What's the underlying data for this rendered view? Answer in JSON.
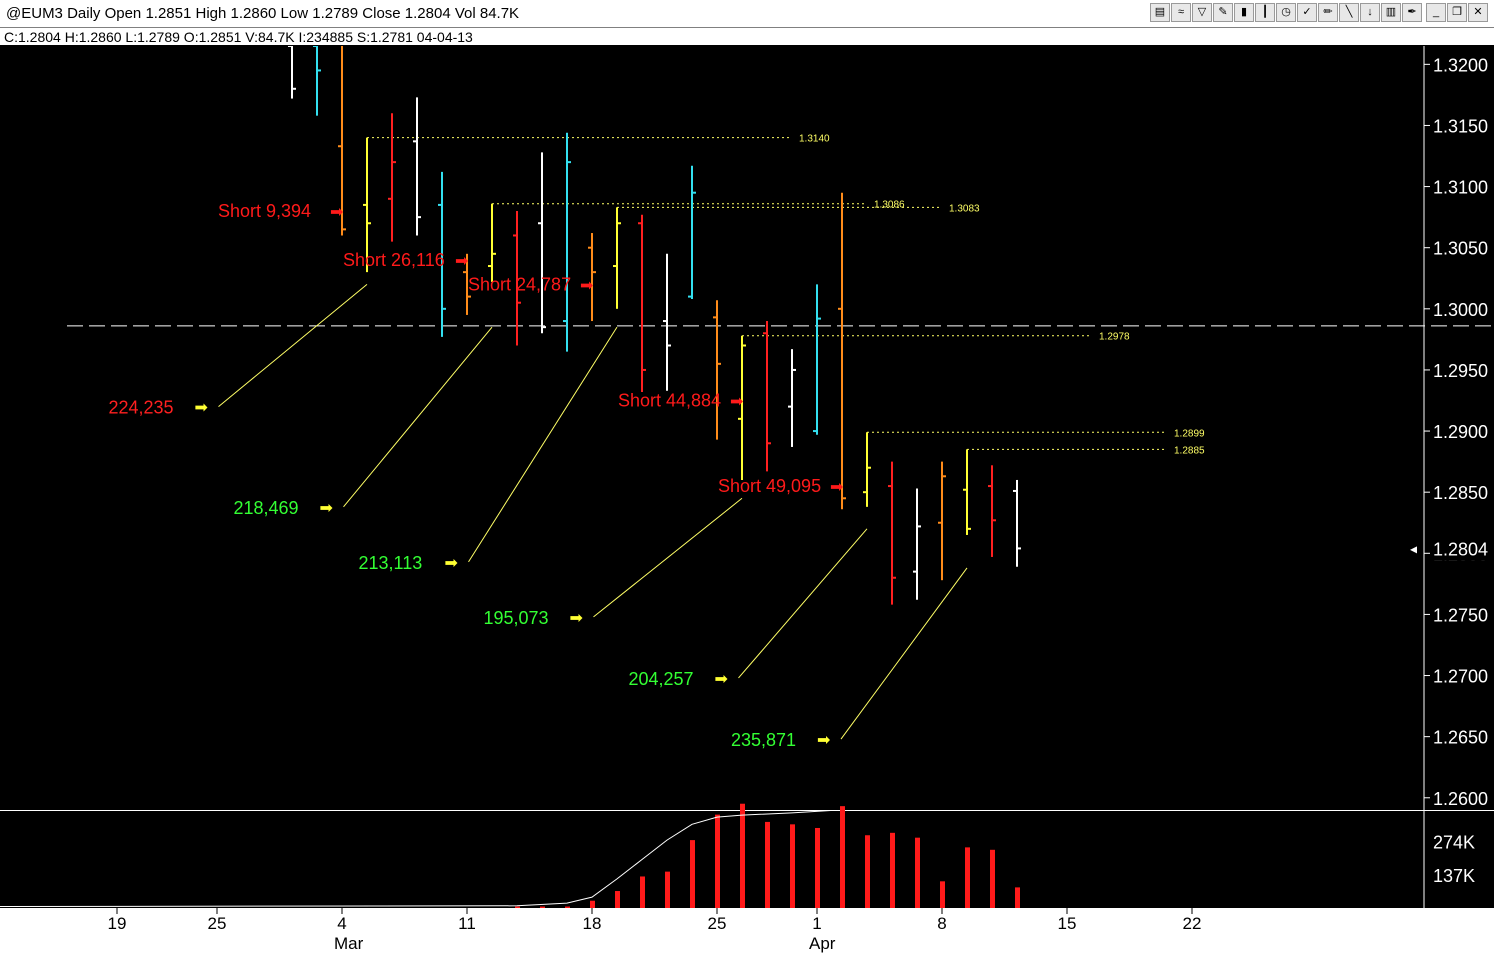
{
  "window": {
    "title": "@EUM3 Daily Open 1.2851 High 1.2860 Low 1.2789 Close 1.2804 Vol 84.7K",
    "status_line": "C:1.2804  H:1.2860  L:1.2789  O:1.2851  V:84.7K  I:234885  S:1.2781  04-04-13",
    "toolbar_icons": [
      "chart-icon",
      "wave-icon",
      "filter-icon",
      "drawing-icon",
      "bars-icon",
      "candle-icon",
      "clock-icon",
      "check-icon",
      "pencil-icon",
      "line-icon",
      "arrow-down-icon",
      "trash-icon",
      "pen-icon",
      "minimize-icon",
      "restore-icon",
      "close-icon"
    ]
  },
  "chart_data": {
    "type": "ohlc",
    "price_ylim": [
      1.259,
      1.3215
    ],
    "volume_ylim": [
      0,
      400000
    ],
    "y_ticks": [
      "1.3200",
      "1.3150",
      "1.3100",
      "1.3050",
      "1.3000",
      "1.2950",
      "1.2900",
      "1.2850",
      "1.2800",
      "1.2750",
      "1.2700",
      "1.2650",
      "1.2600"
    ],
    "last_price_label": "1.2804",
    "volume_ticks": [
      "274K",
      "137K"
    ],
    "x_ticks": [
      {
        "slot": -5,
        "label": "11"
      },
      {
        "slot": 0,
        "label": "19"
      },
      {
        "slot": 4,
        "label": "25"
      },
      {
        "slot": 9,
        "label": "4",
        "month": "Mar"
      },
      {
        "slot": 14,
        "label": "11"
      },
      {
        "slot": 19,
        "label": "18"
      },
      {
        "slot": 24,
        "label": "25"
      },
      {
        "slot": 28,
        "label": "1",
        "month": "Apr"
      },
      {
        "slot": 33,
        "label": "8"
      },
      {
        "slot": 38,
        "label": "15"
      },
      {
        "slot": 43,
        "label": "22"
      }
    ],
    "bars": [
      {
        "slot": 2,
        "o": 1.3215,
        "h": 1.3215,
        "l": 1.3172,
        "c": 1.318,
        "color": "#ffffff",
        "v": 0
      },
      {
        "slot": 3,
        "o": 1.3215,
        "h": 1.3215,
        "l": 1.3158,
        "c": 1.3195,
        "color": "#33e0f0",
        "v": 0
      },
      {
        "slot": 4,
        "o": 1.3133,
        "h": 1.3215,
        "l": 1.306,
        "c": 1.3065,
        "color": "#ff8c1a",
        "v": 0
      },
      {
        "slot": 5,
        "o": 1.3085,
        "h": 1.314,
        "l": 1.303,
        "c": 1.307,
        "color": "#ffff33",
        "v": 0
      },
      {
        "slot": 6,
        "o": 1.309,
        "h": 1.316,
        "l": 1.3055,
        "c": 1.312,
        "color": "#ff2020",
        "v": 0
      },
      {
        "slot": 7,
        "o": 1.3137,
        "h": 1.3173,
        "l": 1.306,
        "c": 1.3075,
        "color": "#ffffff",
        "v": 0
      },
      {
        "slot": 8,
        "o": 1.3085,
        "h": 1.3112,
        "l": 1.2977,
        "c": 1.3,
        "color": "#33e0f0",
        "v": 0
      },
      {
        "slot": 9,
        "o": 1.303,
        "h": 1.3045,
        "l": 1.2995,
        "c": 1.301,
        "color": "#ff8c1a",
        "v": 0
      },
      {
        "slot": 10,
        "o": 1.3035,
        "h": 1.3086,
        "l": 1.3022,
        "c": 1.3045,
        "color": "#ffff33",
        "v": 0
      },
      {
        "slot": 11,
        "o": 1.306,
        "h": 1.308,
        "l": 1.297,
        "c": 1.3005,
        "color": "#ff2020",
        "v": 6000
      },
      {
        "slot": 12,
        "o": 1.307,
        "h": 1.3128,
        "l": 1.298,
        "c": 1.2985,
        "color": "#ffffff",
        "v": 6000
      },
      {
        "slot": 13,
        "o": 1.299,
        "h": 1.3144,
        "l": 1.2965,
        "c": 1.312,
        "color": "#33e0f0",
        "v": 6000
      },
      {
        "slot": 14,
        "o": 1.305,
        "h": 1.3062,
        "l": 1.299,
        "c": 1.303,
        "color": "#ff8c1a",
        "v": 30000
      },
      {
        "slot": 15,
        "o": 1.3035,
        "h": 1.3083,
        "l": 1.3,
        "c": 1.307,
        "color": "#ffff33",
        "v": 70000
      },
      {
        "slot": 16,
        "o": 1.307,
        "h": 1.3077,
        "l": 1.2932,
        "c": 1.295,
        "color": "#ff2020",
        "v": 130000
      },
      {
        "slot": 17,
        "o": 1.299,
        "h": 1.3045,
        "l": 1.2933,
        "c": 1.297,
        "color": "#ffffff",
        "v": 150000
      },
      {
        "slot": 18,
        "o": 1.301,
        "h": 1.3117,
        "l": 1.3008,
        "c": 1.3095,
        "color": "#33e0f0",
        "v": 280000
      },
      {
        "slot": 19,
        "o": 1.2993,
        "h": 1.3007,
        "l": 1.2893,
        "c": 1.2955,
        "color": "#ff8c1a",
        "v": 385000
      },
      {
        "slot": 20,
        "o": 1.291,
        "h": 1.2978,
        "l": 1.286,
        "c": 1.297,
        "color": "#ffff33",
        "v": 430000
      },
      {
        "slot": 21,
        "o": 1.298,
        "h": 1.299,
        "l": 1.2867,
        "c": 1.289,
        "color": "#ff2020",
        "v": 355000
      },
      {
        "slot": 22,
        "o": 1.292,
        "h": 1.2967,
        "l": 1.2887,
        "c": 1.295,
        "color": "#ffffff",
        "v": 345000
      },
      {
        "slot": 23,
        "o": 1.29,
        "h": 1.302,
        "l": 1.2897,
        "c": 1.2992,
        "color": "#33e0f0",
        "v": 330000
      },
      {
        "slot": 24,
        "o": 1.3,
        "h": 1.3095,
        "l": 1.2836,
        "c": 1.2845,
        "color": "#ff8c1a",
        "v": 420000
      },
      {
        "slot": 25,
        "o": 1.285,
        "h": 1.2899,
        "l": 1.2838,
        "c": 1.287,
        "color": "#ffff33",
        "v": 300000
      },
      {
        "slot": 26,
        "o": 1.2855,
        "h": 1.2875,
        "l": 1.2758,
        "c": 1.278,
        "color": "#ff2020",
        "v": 310000
      },
      {
        "slot": 27,
        "o": 1.2785,
        "h": 1.2853,
        "l": 1.2762,
        "c": 1.2822,
        "color": "#ffffff",
        "v": 290000
      },
      {
        "slot": 28,
        "o": 1.2825,
        "h": 1.2875,
        "l": 1.2778,
        "c": 1.2863,
        "color": "#ff8c1a",
        "v": 110000
      },
      {
        "slot": 29,
        "o": 1.2852,
        "h": 1.2885,
        "l": 1.2815,
        "c": 1.282,
        "color": "#ffff33",
        "v": 250000
      },
      {
        "slot": 30,
        "o": 1.2855,
        "h": 1.2872,
        "l": 1.2797,
        "c": 1.2827,
        "color": "#ff2020",
        "v": 240000
      },
      {
        "slot": 31,
        "o": 1.2851,
        "h": 1.286,
        "l": 1.2789,
        "c": 1.2804,
        "color": "#ffffff",
        "v": 85000
      }
    ],
    "open_interest_line": [
      {
        "slot": -17,
        "v": 5000
      },
      {
        "slot": 11,
        "v": 9000
      },
      {
        "slot": 13,
        "v": 20000
      },
      {
        "slot": 14,
        "v": 45000
      },
      {
        "slot": 15,
        "v": 120000
      },
      {
        "slot": 16,
        "v": 200000
      },
      {
        "slot": 17,
        "v": 280000
      },
      {
        "slot": 18,
        "v": 345000
      },
      {
        "slot": 19,
        "v": 375000
      },
      {
        "slot": 20,
        "v": 383000
      },
      {
        "slot": 22,
        "v": 392000
      },
      {
        "slot": 24,
        "v": 405000
      },
      {
        "slot": 25,
        "v": 425000
      },
      {
        "slot": 28,
        "v": 440000
      },
      {
        "slot": 29,
        "v": 465000
      },
      {
        "slot": 31,
        "v": 470000
      }
    ],
    "horizontal_lines": [
      {
        "from_slot": 5,
        "to_slot": 22,
        "price": 1.314,
        "label": "1.3140",
        "color": "#ffff66",
        "style": "dotted"
      },
      {
        "from_slot": 10,
        "to_slot": 25,
        "price": 1.3086,
        "label": "1.3086",
        "color": "#ffff66",
        "style": "dotted"
      },
      {
        "from_slot": 15,
        "to_slot": 28,
        "price": 1.3083,
        "label": "1.3083",
        "color": "#ffff66",
        "style": "dotted"
      },
      {
        "from_slot": 20,
        "to_slot": 34,
        "price": 1.2978,
        "label": "1.2978",
        "color": "#ffff66",
        "style": "dotted"
      },
      {
        "from_slot": 25,
        "to_slot": 37,
        "price": 1.2899,
        "label": "1.2899",
        "color": "#ffff66",
        "style": "dotted"
      },
      {
        "from_slot": 29,
        "to_slot": 37,
        "price": 1.2885,
        "label": "1.2885",
        "color": "#ffff66",
        "style": "dotted"
      },
      {
        "from_slot": -7,
        "to_slot": 51,
        "price": 1.2986,
        "label": "1.2986",
        "color": "#ffffff",
        "style": "dashed"
      }
    ],
    "short_annotations": [
      {
        "text": "Short  9,394",
        "slot": 4,
        "price": 1.308
      },
      {
        "text": "Short  26,116",
        "slot": 9,
        "price": 1.304
      },
      {
        "text": "Short  24,787",
        "slot": 14,
        "price": 1.302
      },
      {
        "text": "Short  44,884",
        "slot": 20,
        "price": 1.2925
      },
      {
        "text": "Short  49,095",
        "slot": 24,
        "price": 1.2855
      }
    ],
    "oi_annotations": [
      {
        "text": "224,235",
        "color": "#ff2020",
        "arrow_slot": -1.5,
        "price": 1.292,
        "line_to_slot": 5,
        "line_to_price": 1.302
      },
      {
        "text": "218,469",
        "color": "#33ff33",
        "arrow_slot": 3.5,
        "price": 1.2838,
        "line_to_slot": 10,
        "line_to_price": 1.2985
      },
      {
        "text": "213,113",
        "color": "#33ff33",
        "arrow_slot": 8.5,
        "price": 1.2793,
        "line_to_slot": 15,
        "line_to_price": 1.2985
      },
      {
        "text": "195,073",
        "color": "#33ff33",
        "arrow_slot": 13.5,
        "price": 1.2748,
        "line_to_slot": 20,
        "line_to_price": 1.2845
      },
      {
        "text": "204,257",
        "color": "#33ff33",
        "arrow_slot": 19.3,
        "price": 1.2698,
        "line_to_slot": 25,
        "line_to_price": 1.282
      },
      {
        "text": "235,871",
        "color": "#33ff33",
        "arrow_slot": 23.4,
        "price": 1.2648,
        "line_to_slot": 29,
        "line_to_price": 1.2788
      }
    ]
  }
}
